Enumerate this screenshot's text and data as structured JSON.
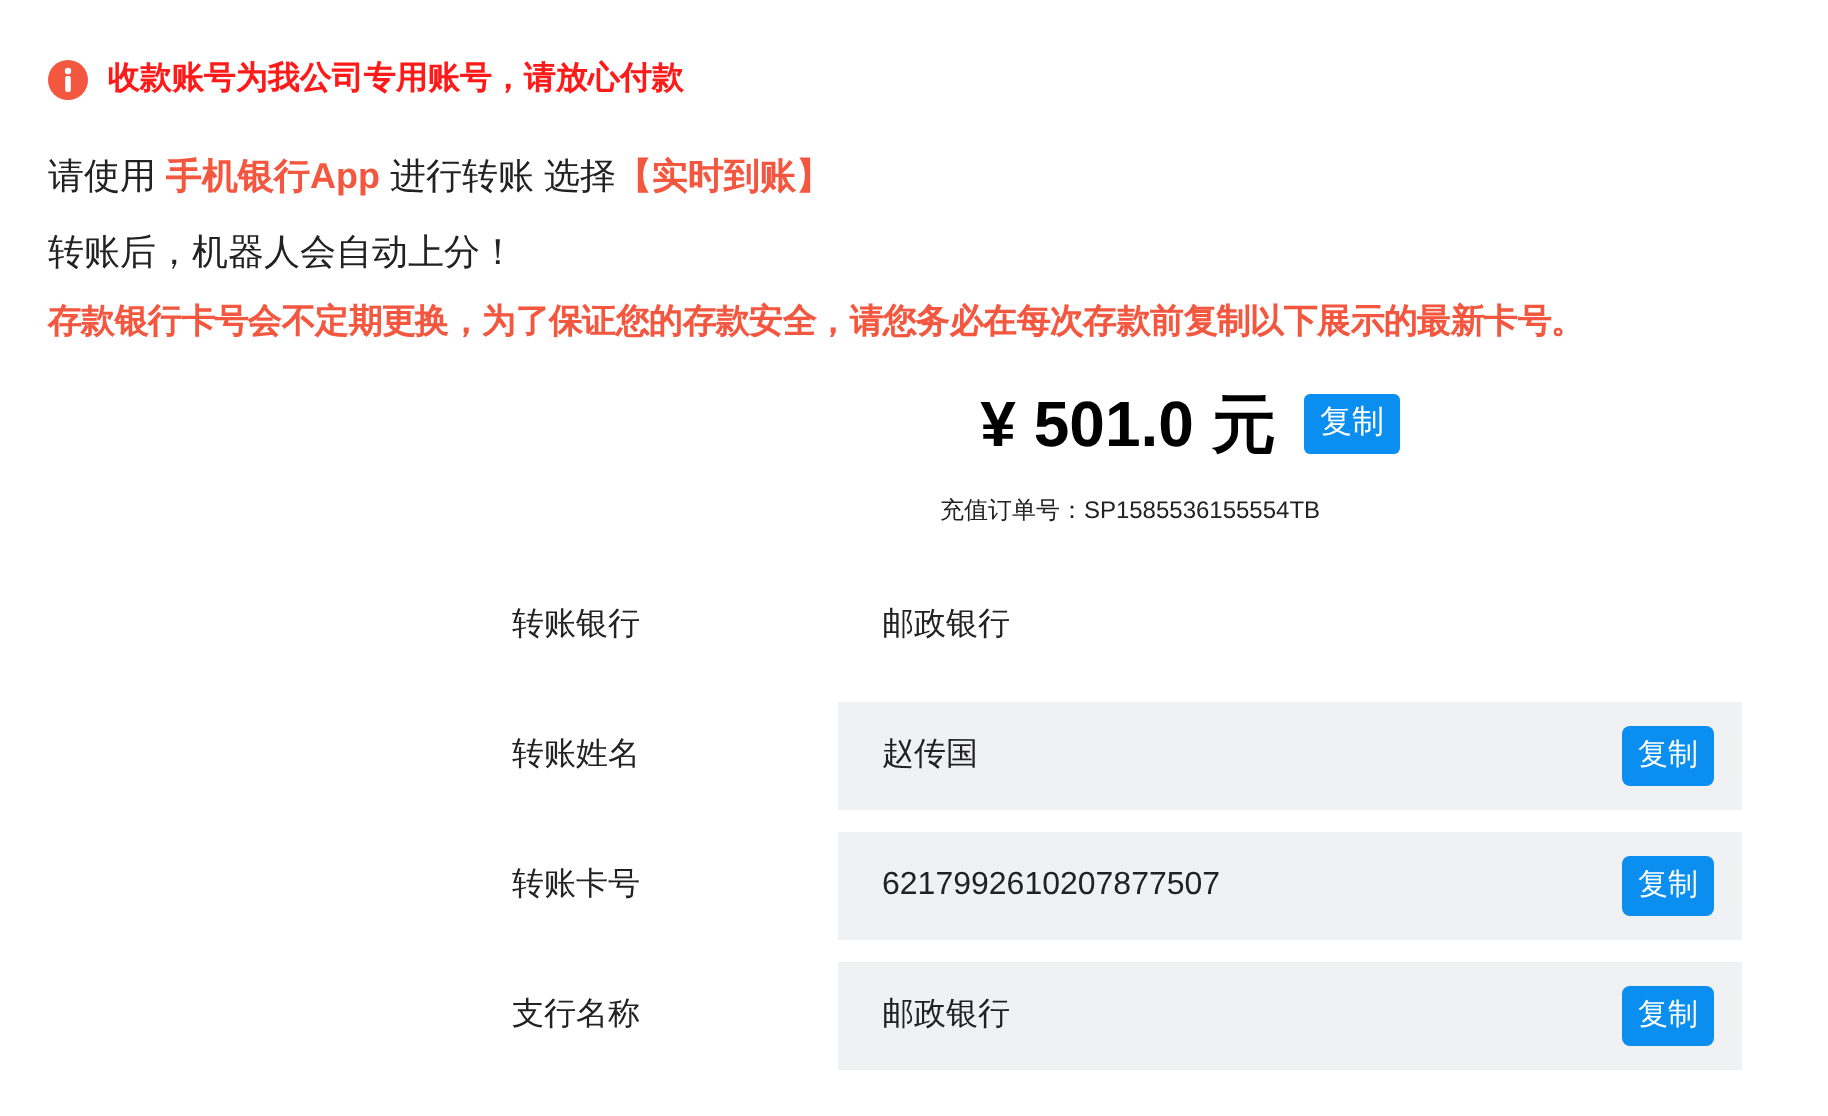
{
  "notice": {
    "text": "收款账号为我公司专用账号，请放心付款"
  },
  "instruction": [
    {
      "text": "请使用 ",
      "highlight": false
    },
    {
      "text": "手机银行App",
      "highlight": true
    },
    {
      "text": " 进行转账 选择",
      "highlight": false
    },
    {
      "text": "【实时到账】",
      "highlight": true
    }
  ],
  "note": "转账后，机器人会自动上分！",
  "warning": "存款银行卡号会不定期更换，为了保证您的存款安全，请您务必在每次存款前复制以下展示的最新卡号。",
  "amount": {
    "value": "¥ 501.0 元",
    "copy": "复制",
    "order": "充值订单号：SP1585536155554TB"
  },
  "fields": [
    {
      "label": "转账银行",
      "value": "邮政银行",
      "kind": "plain"
    },
    {
      "label": "转账姓名",
      "value": "赵传国",
      "kind": "copyable",
      "copy": "复制"
    },
    {
      "label": "转账卡号",
      "value": "6217992610207877507",
      "kind": "copyable",
      "copy": "复制"
    },
    {
      "label": "支行名称",
      "value": "邮政银行",
      "kind": "copyable",
      "copy": "复制"
    }
  ]
}
